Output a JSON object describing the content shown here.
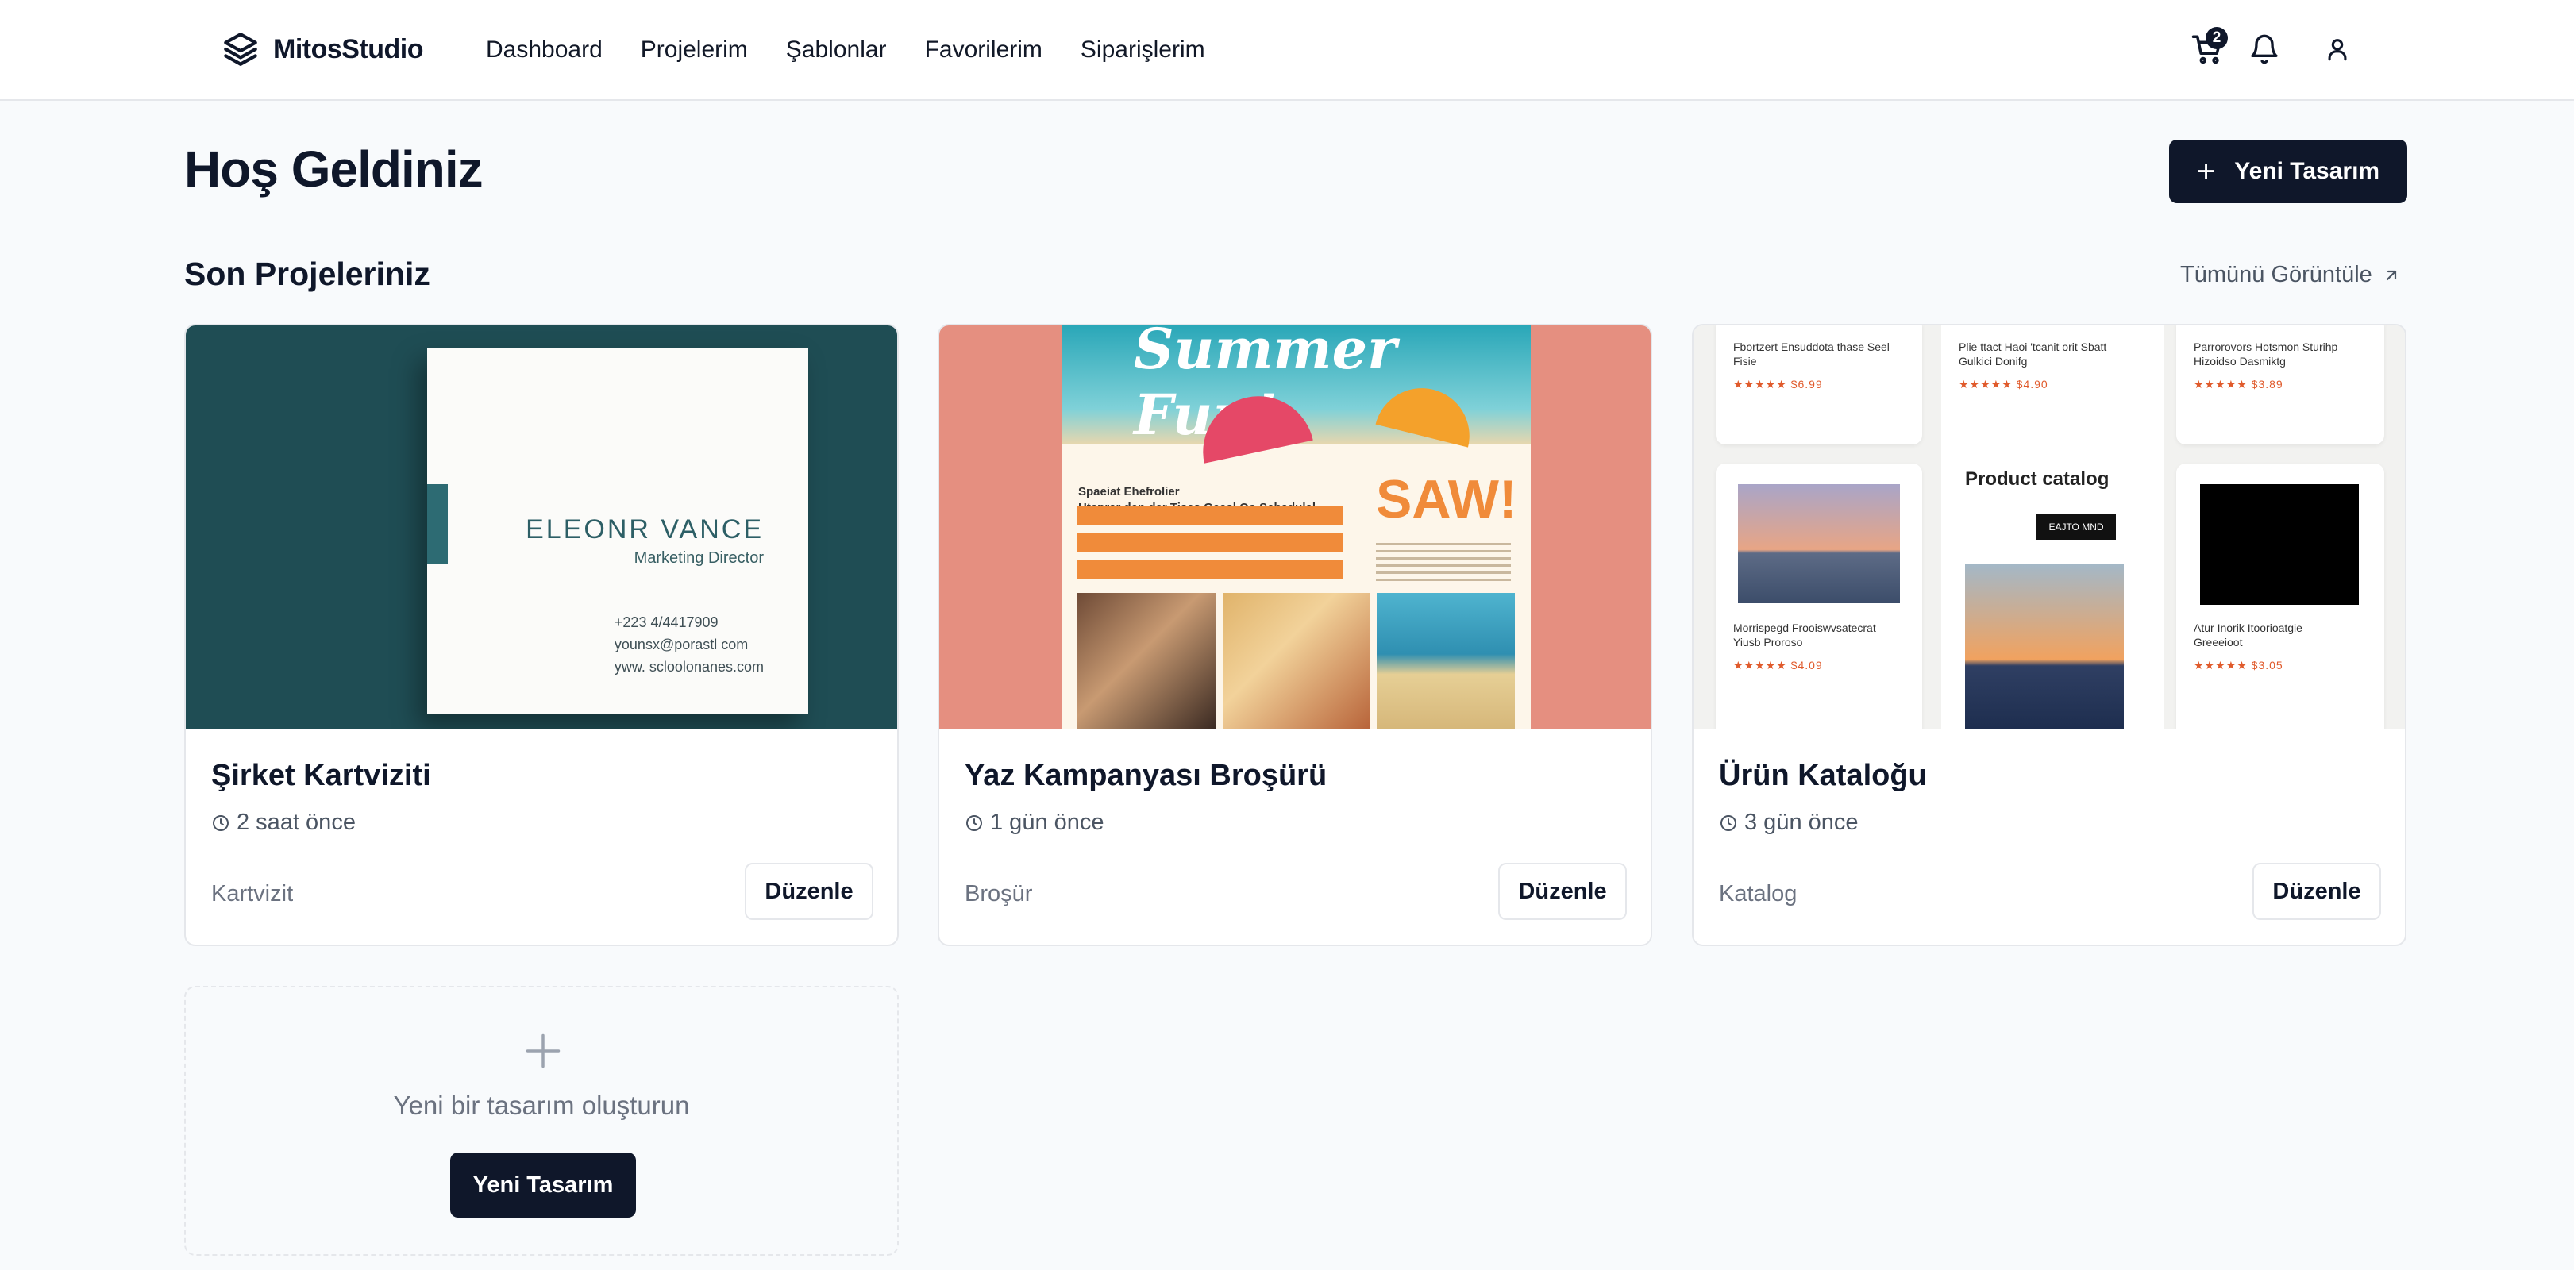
{
  "app": {
    "brand_name": "MitosStudio",
    "brand_icon": "layers-icon"
  },
  "nav": {
    "items": [
      "Dashboard",
      "Projelerim",
      "Şablonlar",
      "Favorilerim",
      "Siparişlerim"
    ]
  },
  "header_icons": {
    "cart_icon": "shopping-cart-icon",
    "cart_count": "2",
    "bell_icon": "bell-icon",
    "user_icon": "user-icon"
  },
  "page": {
    "title": "Hoş Geldiniz",
    "new_design_label": "Yeni Tasarım",
    "section_title": "Son Projeleriniz",
    "view_all_label": "Tümünü Görüntüle"
  },
  "projects": [
    {
      "title": "Şirket Kartviziti",
      "time": "2 saat önce",
      "type": "Kartvizit",
      "edit_label": "Düzenle",
      "thumbnail_text": {
        "name": "ELEONR VANCE",
        "role": "Marketing Director",
        "lines": [
          "+223 4/4417909",
          "younsx@porastl com",
          "yww. scloolonanes.com"
        ]
      }
    },
    {
      "title": "Yaz Kampanyası Broşürü",
      "time": "1 gün önce",
      "type": "Broşür",
      "edit_label": "Düzenle",
      "thumbnail_text": {
        "headline": "Summer Fun!",
        "sub": "SAW!",
        "lines": [
          "Spaeiat Ehefrolier",
          "Htenrar den der Tises Geasl Oo Schadulal"
        ]
      }
    },
    {
      "title": "Ürün Kataloğu",
      "time": "3 gün önce",
      "type": "Katalog",
      "edit_label": "Düzenle",
      "thumbnail_text": {
        "heading": "Product catalog",
        "button": "EAJTO MND",
        "prices": [
          "$6.99",
          "$4.90",
          "$3.89",
          "$4.09",
          "$3.05"
        ]
      }
    }
  ],
  "create_card": {
    "text": "Yeni bir tasarım oluşturun",
    "button_label": "Yeni Tasarım",
    "icon": "plus-icon"
  },
  "colors": {
    "primary": "#0f172a",
    "background": "#f8fafc",
    "border": "#e5e7eb",
    "muted_text": "#6b7280"
  }
}
